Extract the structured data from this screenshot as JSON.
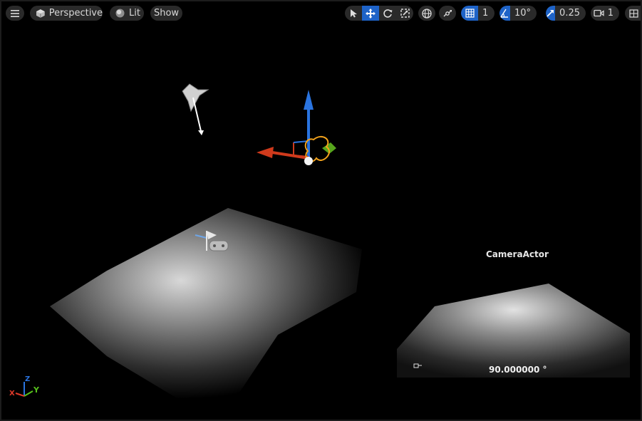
{
  "toolbar": {
    "view_mode": "Perspective",
    "lighting": "Lit",
    "show": "Show",
    "grid_snap_value": "1",
    "rotation_snap_value": "10°",
    "scale_snap_value": "0.25",
    "camera_speed_value": "1"
  },
  "scene": {
    "camera_actor_label": "CameraActor",
    "fov_readout": "90.000000 °"
  },
  "axis_indicator": {
    "x": "X",
    "y": "Y",
    "z": "Z"
  },
  "colors": {
    "accent": "#1e63c8",
    "toolbar_bg": "#2a2a2a",
    "gizmo_x": "#d03a1c",
    "gizmo_y": "#57a51c",
    "gizmo_z": "#2a74e0",
    "selection": "#f2a21c"
  },
  "icons": {
    "menu": "hamburger-icon",
    "perspective": "cube-icon",
    "lit": "sphere-icon",
    "select": "cursor-icon",
    "translate": "move-icon",
    "rotate": "rotate-icon",
    "scale": "scale-icon",
    "world": "globe-icon",
    "surface_snap": "surface-snap-icon",
    "grid": "grid-icon",
    "angle": "angle-icon",
    "scale_snap": "scale-arrow-icon",
    "camera": "camera-icon",
    "layout": "viewport-layout-icon"
  }
}
